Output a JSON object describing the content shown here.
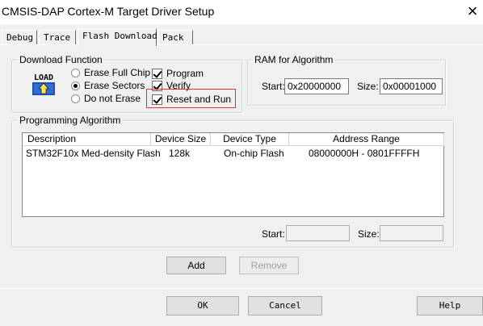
{
  "window": {
    "title": "CMSIS-DAP Cortex-M Target Driver Setup",
    "close_glyph": "×"
  },
  "tabs": [
    {
      "label": "Debug",
      "active": false
    },
    {
      "label": "Trace",
      "active": false
    },
    {
      "label": "Flash Download",
      "active": true
    },
    {
      "label": "Pack",
      "active": false
    }
  ],
  "download_function": {
    "group_label": "Download Function",
    "logo_text": "LOAD",
    "erase_options": [
      {
        "label": "Erase Full Chip",
        "selected": false
      },
      {
        "label": "Erase Sectors",
        "selected": true
      },
      {
        "label": "Do not Erase",
        "selected": false
      }
    ],
    "checks": [
      {
        "label": "Program",
        "checked": true
      },
      {
        "label": "Verify",
        "checked": true
      },
      {
        "label": "Reset and Run",
        "checked": true
      }
    ]
  },
  "ram": {
    "group_label": "RAM for Algorithm",
    "start_label": "Start:",
    "start_value": "0x20000000",
    "size_label": "Size:",
    "size_value": "0x00001000"
  },
  "programming": {
    "group_label": "Programming Algorithm",
    "columns": [
      "Description",
      "Device Size",
      "Device Type",
      "Address Range"
    ],
    "rows": [
      {
        "description": "STM32F10x Med-density Flash",
        "size": "128k",
        "type": "On-chip Flash",
        "range": "08000000H - 0801FFFFH"
      }
    ],
    "start_label": "Start:",
    "start_value": "",
    "size_label": "Size:",
    "size_value": "",
    "add_label": "Add",
    "remove_label": "Remove"
  },
  "footer": {
    "ok_label": "OK",
    "cancel_label": "Cancel",
    "help_label": "Help"
  },
  "colors": {
    "highlight": "#e03030",
    "load_icon_arrow": "#2f6fd6",
    "load_icon_base": "#1f4fb0"
  }
}
